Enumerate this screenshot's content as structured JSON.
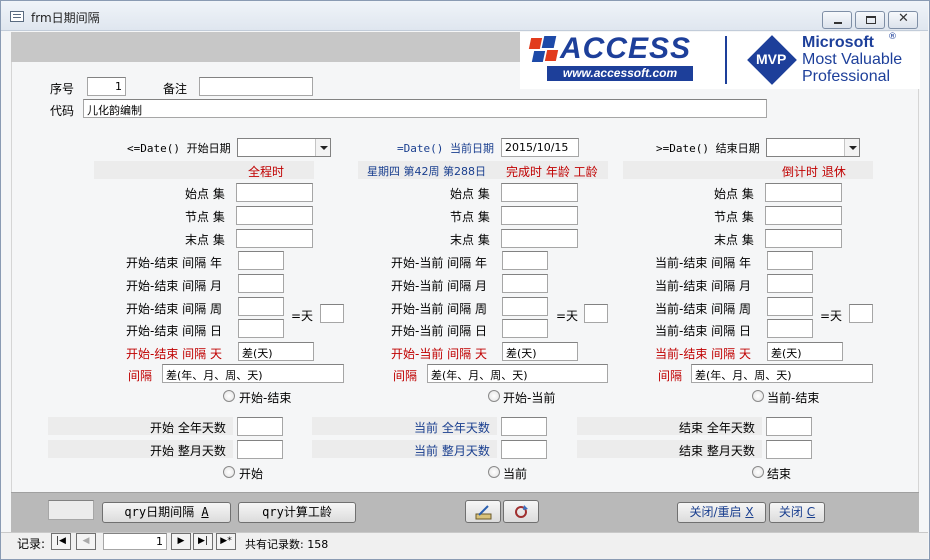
{
  "window": {
    "title": "frm日期间隔"
  },
  "top": {
    "seq_label": "序号",
    "seq_value": "1",
    "note_label": "备注",
    "note_value": "",
    "code_label": "代码",
    "code_value": "儿化韵编制"
  },
  "logo": {
    "access": "ACCESS",
    "url": "www.accessoft.com",
    "mvp": "MVP",
    "ms1": "Microsoft",
    "ms2": "Most Valuable",
    "ms3": "Professional",
    "reg": "®"
  },
  "col1": {
    "date_label": "<=Date() 开始日期",
    "date_value": "",
    "header": "全程时",
    "start": "始点 集",
    "node": "节点 集",
    "end": "末点 集",
    "r_year": "开始-结束 间隔 年",
    "r_month": "开始-结束 间隔 月",
    "r_week": "开始-结束 间隔 周",
    "eq_day": "=天",
    "r_day": "开始-结束 间隔 日",
    "r_diff_label": "开始-结束 间隔 天",
    "r_diff_value": "差(天)",
    "r_gap_label": "间隔",
    "r_gap_value": "差(年、月、周、天)",
    "radio1": "开始-结束",
    "full_year": "开始 全年天数",
    "full_month": "开始 整月天数",
    "radio2": "开始"
  },
  "col2": {
    "date_label": "=Date() 当前日期",
    "date_value": "2015/10/15",
    "header_blue": "星期四 第42周 第288日",
    "header_red": "完成时 年龄 工龄",
    "start": "始点 集",
    "node": "节点 集",
    "end": "末点 集",
    "r_year": "开始-当前 间隔 年",
    "r_month": "开始-当前 间隔 月",
    "r_week": "开始-当前 间隔 周",
    "eq_day": "=天",
    "r_day": "开始-当前 间隔 日",
    "r_diff_label": "开始-当前 间隔 天",
    "r_diff_value": "差(天)",
    "r_gap_label": "间隔",
    "r_gap_value": "差(年、月、周、天)",
    "radio1": "开始-当前",
    "full_year": "当前 全年天数",
    "full_month": "当前 整月天数",
    "radio2": "当前"
  },
  "col3": {
    "date_label": ">=Date() 结束日期",
    "date_value": "",
    "header": "倒计时 退休",
    "start": "始点 集",
    "node": "节点 集",
    "end": "末点 集",
    "r_year": "当前-结束 间隔 年",
    "r_month": "当前-结束 间隔 月",
    "r_week": "当前-结束 间隔 周",
    "eq_day": "=天",
    "r_day": "当前-结束 间隔 日",
    "r_diff_label": "当前-结束 间隔 天",
    "r_diff_value": "差(天)",
    "r_gap_label": "间隔",
    "r_gap_value": "差(年、月、周、天)",
    "radio1": "当前-结束",
    "full_year": "结束 全年天数",
    "full_month": "结束 整月天数",
    "radio2": "结束"
  },
  "footer": {
    "qry_interval": "qry日期间隔",
    "qry_interval_key": "A",
    "qry_work": "qry计算工龄",
    "close_reset": "关闭/重启",
    "close_reset_key": "X",
    "close": "关闭",
    "close_key": "C"
  },
  "nav": {
    "label": "记录:",
    "current": "1",
    "total_label": "共有记录数: 158"
  },
  "colors": {
    "red": "#c00000",
    "blue": "#1a3f8f",
    "footer": "#b9b9b9"
  }
}
